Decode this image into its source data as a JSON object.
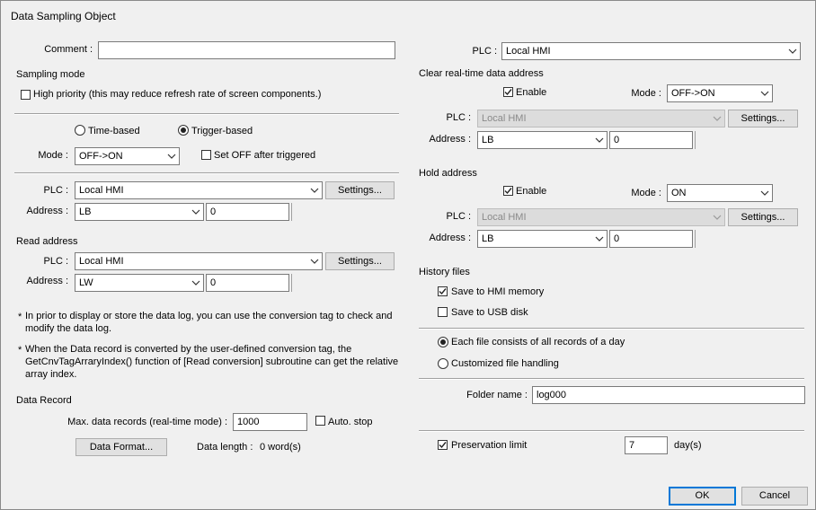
{
  "window": {
    "title": "Data Sampling Object"
  },
  "left": {
    "comment_label": "Comment :",
    "comment_value": "",
    "sampling_mode_heading": "Sampling mode",
    "high_priority_label": "High priority (this may reduce refresh rate of screen components.)",
    "time_based_label": "Time-based",
    "trigger_based_label": "Trigger-based",
    "mode_label": "Mode :",
    "mode_value": "OFF->ON",
    "set_off_label": "Set OFF after triggered",
    "plc_label": "PLC :",
    "plc_value": "Local HMI",
    "settings_label": "Settings...",
    "address_label": "Address :",
    "address_device": "LB",
    "address_value": "0",
    "read_heading": "Read address",
    "read_plc_label": "PLC :",
    "read_plc_value": "Local HMI",
    "read_settings_label": "Settings...",
    "read_address_label": "Address :",
    "read_address_device": "LW",
    "read_address_value": "0",
    "note1_star": "*",
    "note1_line1": "In prior to display or store the data log, you can use the conversion tag to check and",
    "note1_line2": "modify the data log.",
    "note2_star": "*",
    "note2_line1": "When the Data record is converted by the user-defined conversion tag, the",
    "note2_line2": "GetCnvTagArraryIndex() function of [Read conversion] subroutine can get the relative",
    "note2_line3": "array index.",
    "data_record_heading": "Data Record",
    "max_records_label": "Max. data records (real-time mode) :",
    "max_records_value": "1000",
    "auto_stop_label": "Auto. stop",
    "data_format_label": "Data Format...",
    "data_length_label": "Data length :",
    "data_length_value": "0 word(s)"
  },
  "right": {
    "plc_label": "PLC :",
    "plc_value": "Local HMI",
    "clear_heading": "Clear real-time data address",
    "clear_enable_label": "Enable",
    "clear_mode_label": "Mode :",
    "clear_mode_value": "OFF->ON",
    "clear_plc_label": "PLC :",
    "clear_plc_value": "Local HMI",
    "clear_settings_label": "Settings...",
    "clear_address_label": "Address :",
    "clear_address_device": "LB",
    "clear_address_value": "0",
    "hold_heading": "Hold address",
    "hold_enable_label": "Enable",
    "hold_mode_label": "Mode :",
    "hold_mode_value": "ON",
    "hold_plc_label": "PLC :",
    "hold_plc_value": "Local HMI",
    "hold_settings_label": "Settings...",
    "hold_address_label": "Address :",
    "hold_address_device": "LB",
    "hold_address_value": "0",
    "history_heading": "History files",
    "save_hmi_label": "Save to HMI memory",
    "save_usb_label": "Save to USB disk",
    "each_file_label": "Each file consists of all records of a day",
    "customized_label": "Customized file handling",
    "folder_label": "Folder name :",
    "folder_value": "log000",
    "preservation_label": "Preservation limit",
    "preservation_value": "7",
    "preservation_unit": "day(s)"
  },
  "footer": {
    "ok_label": "OK",
    "cancel_label": "Cancel"
  }
}
